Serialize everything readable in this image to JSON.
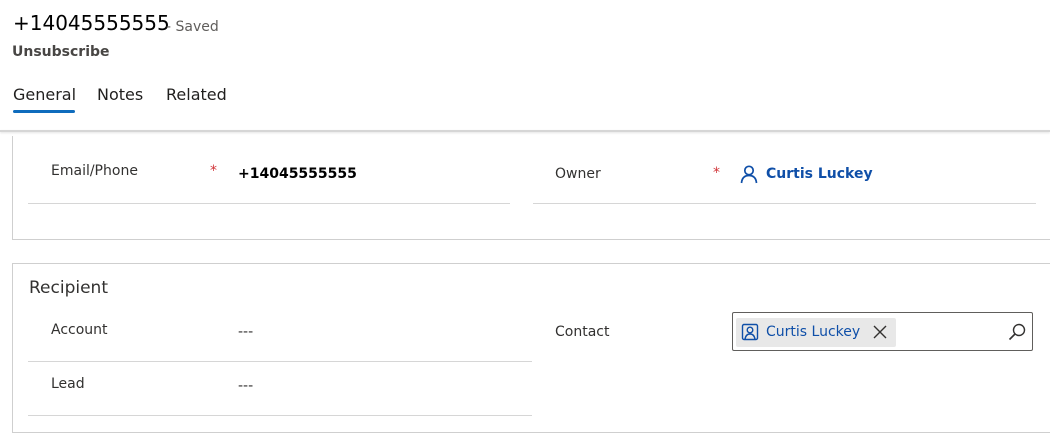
{
  "record": {
    "title": "+14045555555",
    "status": "- Saved",
    "subtitle": "Unsubscribe"
  },
  "tabs": [
    {
      "label": "General",
      "selected": true
    },
    {
      "label": "Notes",
      "selected": false
    },
    {
      "label": "Related",
      "selected": false
    }
  ],
  "general": {
    "email_phone": {
      "label": "Email/Phone",
      "required_marker": "*",
      "value": "+14045555555"
    },
    "owner": {
      "label": "Owner",
      "required_marker": "*",
      "value": "Curtis Luckey"
    }
  },
  "recipient": {
    "section_title": "Recipient",
    "account": {
      "label": "Account",
      "value": "---"
    },
    "lead": {
      "label": "Lead",
      "value": "---"
    },
    "contact": {
      "label": "Contact",
      "value": "Curtis Luckey"
    }
  },
  "colors": {
    "accent": "#0f6cbd",
    "link": "#0f4fa8",
    "required": "#d13438"
  },
  "icons": {
    "owner": "user-icon",
    "contact_tag": "contact-card-icon",
    "remove": "close-icon",
    "search": "search-icon"
  }
}
